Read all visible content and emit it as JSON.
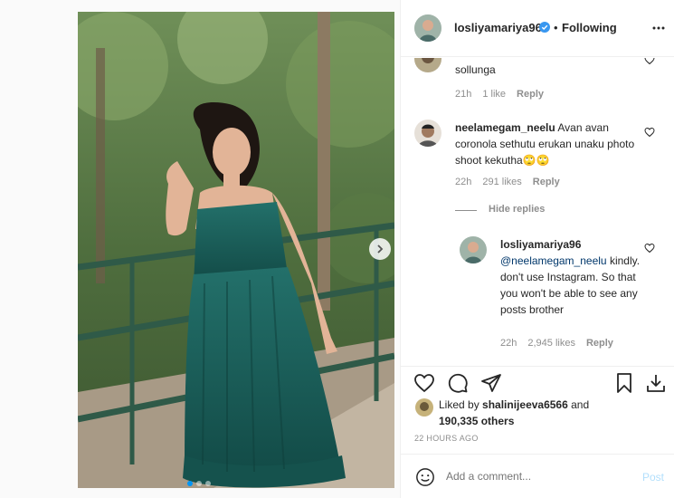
{
  "post": {
    "username": "losliyamariya96",
    "dot": "•",
    "follow_status": "Following",
    "carousel_dots": 3
  },
  "comments": [
    {
      "text": "sollunga",
      "age": "21h",
      "likes": "1 like",
      "reply": "Reply"
    },
    {
      "username": "neelamegam_neelu",
      "text": "Avan avan coronola sethutu erukan unaku photo shoot kekutha🙄🙄",
      "age": "22h",
      "likes": "291 likes",
      "reply": "Reply"
    }
  ],
  "hide_replies": "Hide replies",
  "reply": {
    "username": "losliyamariya96",
    "mention": "@neelamegam_neelu",
    "text": "kindly. don't use Instagram. So that you won't be able to see any posts brother",
    "age": "22h",
    "likes": "2,945 likes",
    "reply": "Reply"
  },
  "likes_summary": {
    "prefix": "Liked by",
    "liker": "shalinijeeva6566",
    "and": "and",
    "others": "190,335 others"
  },
  "timestamp": "22 HOURS AGO",
  "add_comment": {
    "placeholder": "Add a comment...",
    "post_label": "Post"
  },
  "colors": {
    "accent": "#0095f6",
    "muted": "#8e8e8e",
    "post_disabled": "#b2dffc",
    "dress": "#1f5f5a"
  }
}
